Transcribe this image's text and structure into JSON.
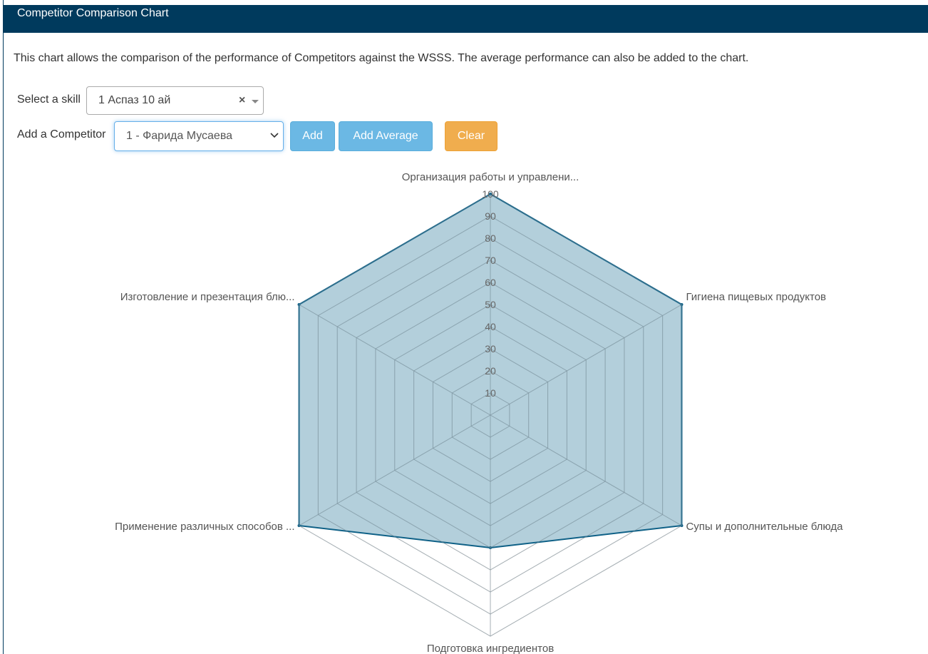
{
  "header": {
    "title": "Competitor Comparison Chart"
  },
  "description": "This chart allows the comparison of the performance of Competitors against the WSSS. The average performance can also be added to the chart.",
  "controls": {
    "skill_label": "Select a skill",
    "skill_value": "1 Аспаз 10 ай",
    "skill_clear": "×",
    "competitor_label": "Add a Competitor",
    "competitor_value": "1 - Фарида Мусаева",
    "add_label": "Add",
    "add_average_label": "Add Average",
    "clear_label": "Clear"
  },
  "colors": {
    "header_bg": "#003a5d",
    "btn_info": "#6bb8e4",
    "btn_warning": "#f0ad4e",
    "series_stroke": "#0f6187",
    "series_fill": "rgba(116,167,189,0.55)",
    "grid": "#cccccc"
  },
  "chart_data": {
    "type": "radar",
    "categories": [
      "Организация работы и управлени...",
      "Гигиена пищевых продуктов",
      "Супы и дополнительные блюда",
      "Подготовка ингредиентов",
      "Применение различных способов ...",
      "Изготовление и презентация блю..."
    ],
    "series": [
      {
        "values": [
          100,
          100,
          100,
          60,
          100,
          100
        ]
      }
    ],
    "ticks": [
      "10",
      "20",
      "30",
      "40",
      "50",
      "60",
      "70",
      "80",
      "90",
      "100"
    ],
    "range": [
      0,
      100
    ],
    "grid": true
  }
}
